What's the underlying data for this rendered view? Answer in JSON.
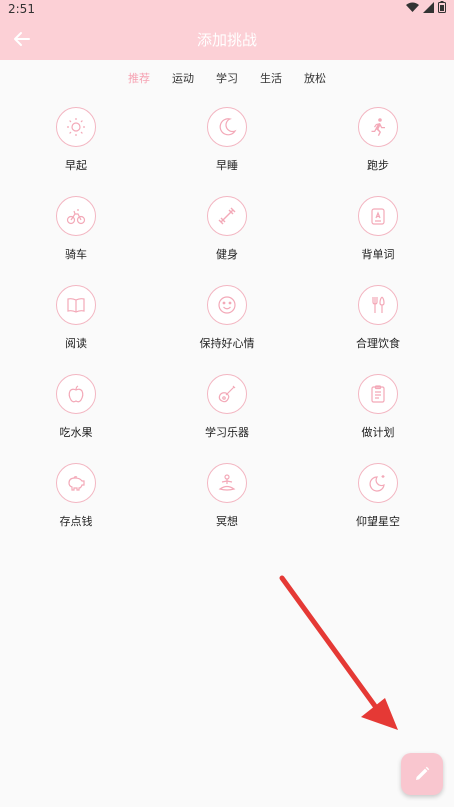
{
  "status": {
    "time": "2:51"
  },
  "appbar": {
    "title": "添加挑战"
  },
  "tabs": [
    "推荐",
    "运动",
    "学习",
    "生活",
    "放松"
  ],
  "items": [
    {
      "label": "早起",
      "icon": "sun-icon"
    },
    {
      "label": "早睡",
      "icon": "moon-icon"
    },
    {
      "label": "跑步",
      "icon": "running-icon"
    },
    {
      "label": "骑车",
      "icon": "bike-icon"
    },
    {
      "label": "健身",
      "icon": "dumbbell-icon"
    },
    {
      "label": "背单词",
      "icon": "flashcard-icon"
    },
    {
      "label": "阅读",
      "icon": "book-icon"
    },
    {
      "label": "保持好心情",
      "icon": "smile-icon"
    },
    {
      "label": "合理饮食",
      "icon": "utensils-icon"
    },
    {
      "label": "吃水果",
      "icon": "apple-icon"
    },
    {
      "label": "学习乐器",
      "icon": "guitar-icon"
    },
    {
      "label": "做计划",
      "icon": "clipboard-icon"
    },
    {
      "label": "存点钱",
      "icon": "piggy-bank-icon"
    },
    {
      "label": "冥想",
      "icon": "meditation-icon"
    },
    {
      "label": "仰望星空",
      "icon": "night-sky-icon"
    }
  ],
  "colors": {
    "accent": "#f3b6c2",
    "appbar": "#fcd0d6",
    "arrow": "#e53935"
  }
}
